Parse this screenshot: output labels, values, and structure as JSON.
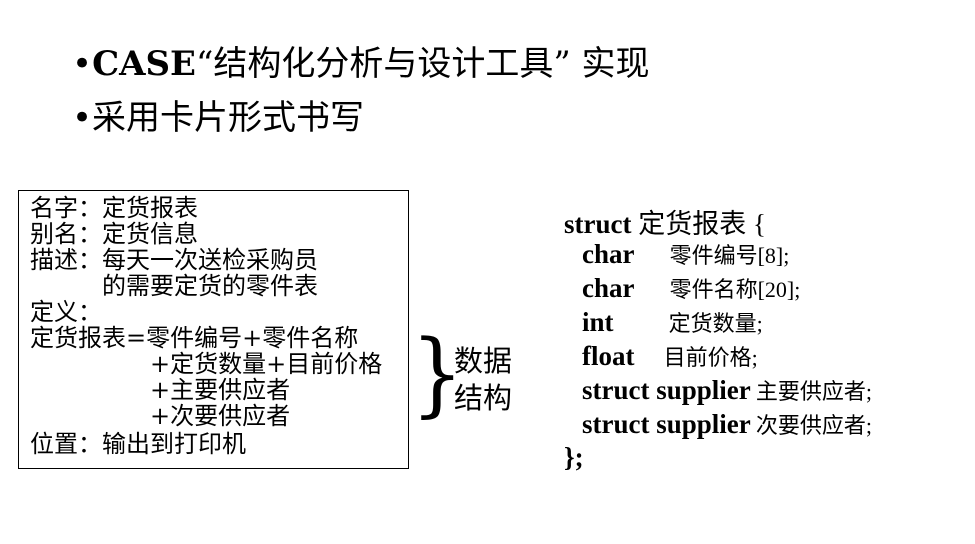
{
  "bullets": {
    "b1_dot": "•",
    "b1_bold": "CASE",
    "b1_rest": "“结构化分析与设计工具” 实现",
    "b2": "•采用卡片形式书写"
  },
  "card": {
    "lines": [
      "名字：定货报表",
      "别名：定货信息",
      "描述：每天一次送检采购员",
      "　　　的需要定货的零件表",
      "定义：",
      "定货报表=零件编号+零件名称",
      "　　　　　+定货数量+目前价格",
      "　　　　　+主要供应者",
      "　　　　　+次要供应者",
      "位置：输出到打印机"
    ]
  },
  "side_label": {
    "line1": "数据",
    "line2": "结构"
  },
  "code": {
    "l1_kw": "struct",
    "l1_rest": " 定货报表 {",
    "l2_kw": "char",
    "l2_rest": "零件编号[8];",
    "l3_kw": "char",
    "l3_rest": "零件名称[20];",
    "l4_kw": "int",
    "l4_rest": "定货数量;",
    "l5_kw": "float",
    "l5_rest": "目前价格;",
    "l6_kw": "struct supplier",
    "l6_rest": "主要供应者;",
    "l7_kw": "struct supplier",
    "l7_rest": "次要供应者;",
    "l8": "};"
  }
}
